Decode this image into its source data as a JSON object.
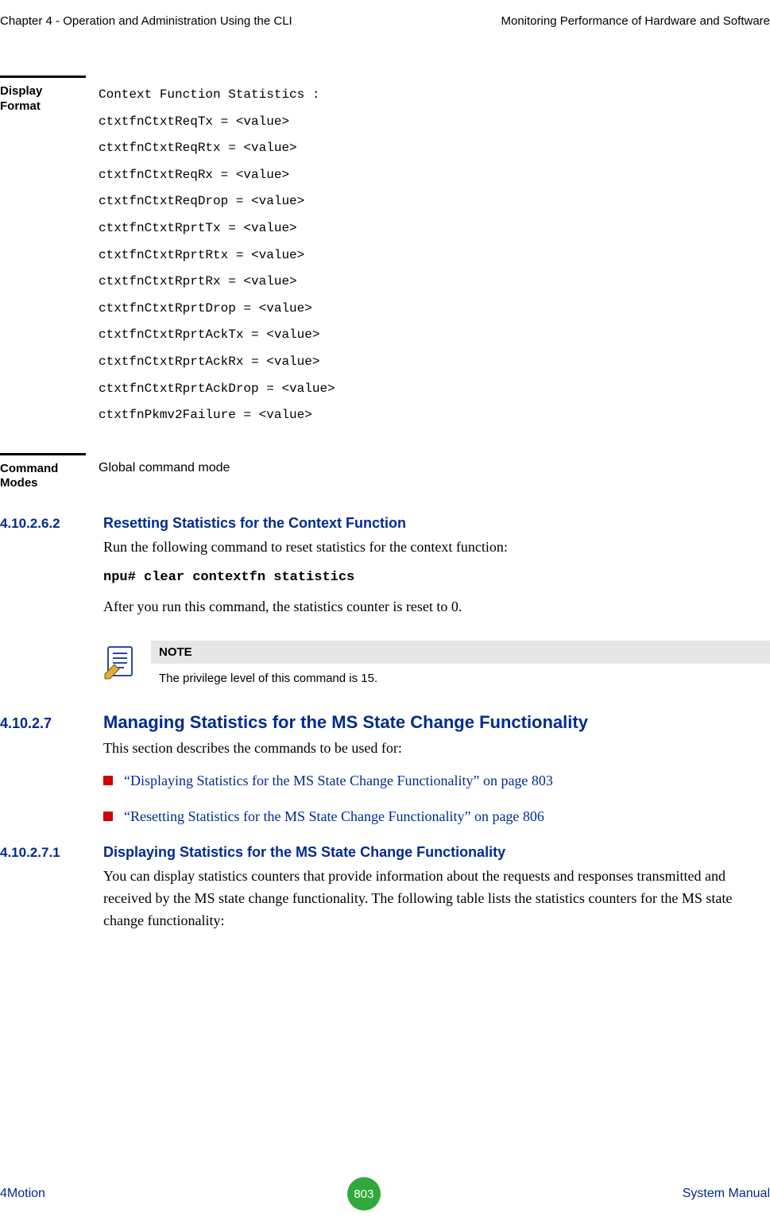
{
  "header": {
    "left": "Chapter 4 - Operation and Administration Using the CLI",
    "right": "Monitoring Performance of Hardware and Software"
  },
  "display_format": {
    "label": "Display Format",
    "lines": "Context Function Statistics :\nctxtfnCtxtReqTx = <value>\nctxtfnCtxtReqRtx = <value>\nctxtfnCtxtReqRx = <value>\nctxtfnCtxtReqDrop = <value>\nctxtfnCtxtRprtTx = <value>\nctxtfnCtxtRprtRtx = <value>\nctxtfnCtxtRprtRx = <value>\nctxtfnCtxtRprtDrop = <value>\nctxtfnCtxtRprtAckTx = <value>\nctxtfnCtxtRprtAckRx = <value>\nctxtfnCtxtRprtAckDrop = <value>\nctxtfnPkmv2Failure = <value>"
  },
  "command_modes": {
    "label": "Command Modes",
    "value": "Global command mode"
  },
  "sec_4_10_2_6_2": {
    "num": "4.10.2.6.2",
    "title": "Resetting Statistics for the Context Function",
    "intro": "Run the following command to reset statistics for the context function:",
    "code": "npu# clear contextfn statistics",
    "after": "After you run this command, the statistics counter is reset to 0."
  },
  "note": {
    "label": "NOTE",
    "text": "The privilege level of this command is 15."
  },
  "sec_4_10_2_7": {
    "num": "4.10.2.7",
    "title": "Managing Statistics for the MS State Change Functionality",
    "intro": "This section describes the commands to be used for:",
    "links": [
      "“Displaying Statistics for the MS State Change Functionality” on page 803",
      "“Resetting Statistics for the MS State Change Functionality” on page 806"
    ]
  },
  "sec_4_10_2_7_1": {
    "num": "4.10.2.7.1",
    "title": "Displaying Statistics for the MS State Change Functionality",
    "body": "You can display statistics counters that provide information about the requests and responses transmitted and received by the MS state change functionality. The following table lists the statistics counters for the MS state change functionality:"
  },
  "footer": {
    "left": "4Motion",
    "page": "803",
    "right": "System Manual"
  }
}
